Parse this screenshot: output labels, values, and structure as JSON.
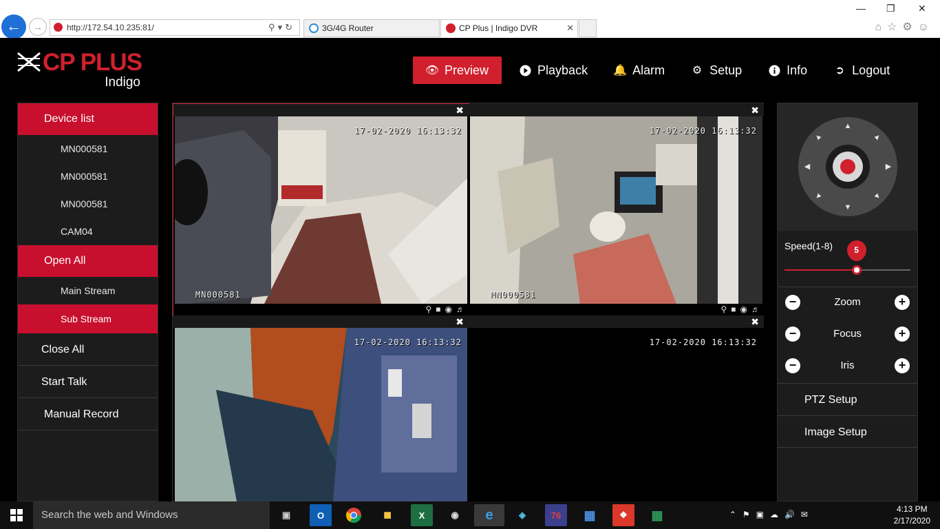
{
  "browser": {
    "url": "http://172.54.10.235:81/",
    "tabs": [
      {
        "label": "3G/4G Router"
      },
      {
        "label": "CP Plus | Indigo DVR"
      }
    ]
  },
  "brand": {
    "name": "CP PLUS",
    "product": "Indigo",
    "color": "#d0202e"
  },
  "nav": {
    "preview": "Preview",
    "playback": "Playback",
    "alarm": "Alarm",
    "setup": "Setup",
    "info": "Info",
    "logout": "Logout"
  },
  "left_panel": {
    "device_list": "Device list",
    "devices": [
      "MN000581",
      "MN000581",
      "MN000581",
      "CAM04"
    ],
    "open_all": "Open All",
    "main_stream": "Main Stream",
    "sub_stream": "Sub Stream",
    "close_all": "Close All",
    "start_talk": "Start Talk",
    "manual_record": "Manual Record"
  },
  "cameras": [
    {
      "timestamp": "17-02-2020 16:13:32",
      "name": "MN000581"
    },
    {
      "timestamp": "17-02-2020 16:13:32",
      "name": "MN000581"
    },
    {
      "timestamp": "17-02-2020 16:13:32",
      "name": ""
    },
    {
      "timestamp": "17-02-2020 16:13:32",
      "name": ""
    }
  ],
  "ptz": {
    "speed_label": "Speed(1-8)",
    "speed_value": "5",
    "speed_min": 1,
    "speed_max": 8,
    "zoom": "Zoom",
    "focus": "Focus",
    "iris": "Iris",
    "ptz_setup": "PTZ Setup",
    "image_setup": "Image Setup"
  },
  "taskbar": {
    "search_placeholder": "Search the web and Windows",
    "time": "4:13 PM",
    "date": "2/17/2020"
  }
}
